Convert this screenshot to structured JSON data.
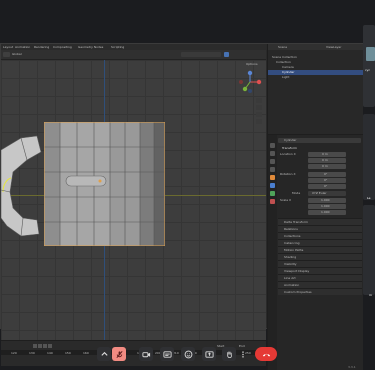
{
  "blender": {
    "top_menu": [
      "Layout",
      "Animation",
      "Rendering",
      "Compositing",
      "Geometry Nodes",
      "Scripting"
    ],
    "toolbar": {
      "mode": "Global"
    },
    "viewport_overlay": {
      "options": "Options"
    },
    "outliner": {
      "scene": "Scene",
      "view_layer": "ViewLayer",
      "items": [
        "Scene Collection",
        "Collection",
        "Camera",
        "Cylinder",
        "Light"
      ]
    },
    "properties": {
      "object_name": "Cylinder",
      "section_transform": "Transform",
      "location_label": "Location X",
      "location": [
        "0 m",
        "0 m",
        "0 m"
      ],
      "rotation_label": "Rotation X",
      "rotation": [
        "0°",
        "0°",
        "0°"
      ],
      "mode_label": "Mode",
      "mode_value": "XYZ Euler",
      "scale_label": "Scale X",
      "scale": [
        "1.000",
        "1.000",
        "1.000"
      ],
      "collapsed": [
        "Delta Transform",
        "Relations",
        "Collections",
        "Instancing",
        "Motion Paths",
        "Shading",
        "Visibility",
        "Viewport Display",
        "Line Art",
        "Animation",
        "Custom Properties"
      ]
    },
    "timeline": {
      "frame_start": "Start",
      "frame_end": "End",
      "ticks": [
        "120",
        "130",
        "140",
        "150",
        "160",
        "170",
        "180",
        "190",
        "200",
        "210",
        "220",
        "230",
        "240",
        "250"
      ]
    },
    "status_version": "3.3.1"
  },
  "side_labels": {
    "top": "cyc",
    "middle": "Le",
    "bottom": "m"
  },
  "controls": {
    "icons": [
      "chevron-up-icon",
      "mic-muted-icon",
      "camera-icon",
      "captions-icon",
      "emoji-icon",
      "present-icon",
      "hand-icon",
      "more-icon",
      "end-call-icon"
    ],
    "end_color": "#e53935",
    "active_color": "#f28b82"
  }
}
